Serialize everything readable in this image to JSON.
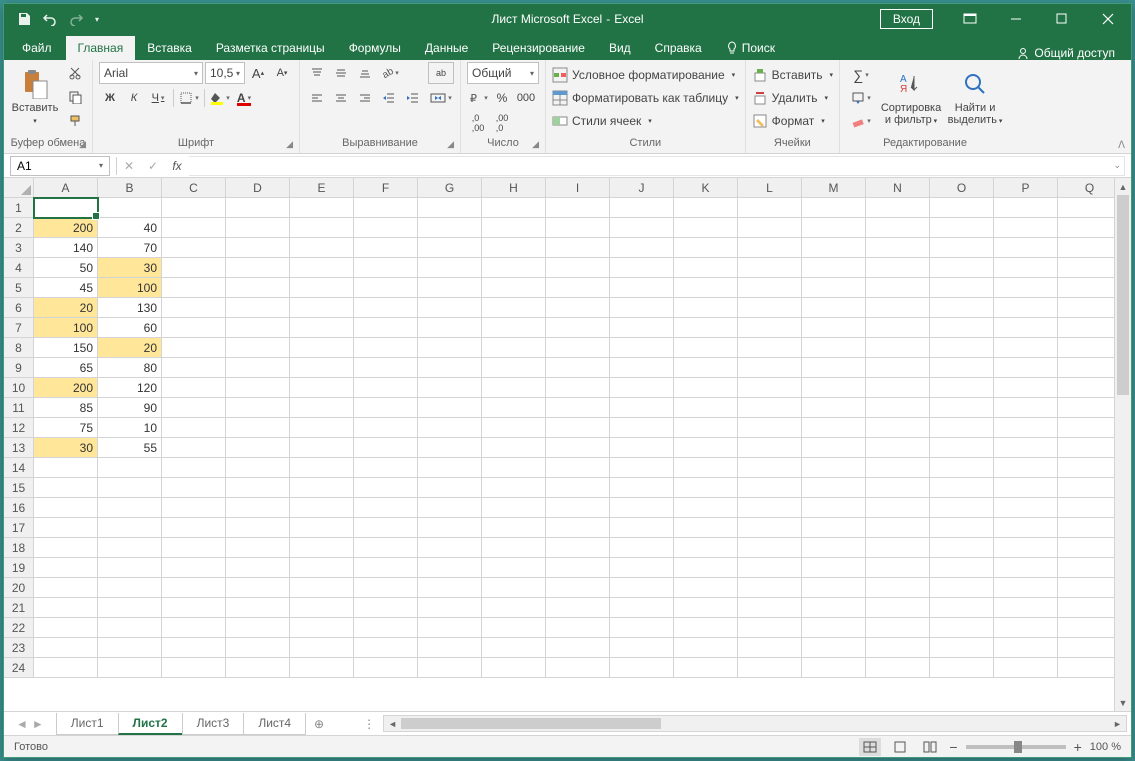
{
  "title": {
    "doc": "Лист Microsoft Excel",
    "sep": "-",
    "app": "Excel"
  },
  "signin": "Вход",
  "tabs": [
    "Файл",
    "Главная",
    "Вставка",
    "Разметка страницы",
    "Формулы",
    "Данные",
    "Рецензирование",
    "Вид",
    "Справка"
  ],
  "active_tab": 1,
  "search": "Поиск",
  "share": "Общий доступ",
  "ribbon": {
    "clipboard": {
      "paste": "Вставить",
      "label": "Буфер обмена"
    },
    "font": {
      "name": "Arial",
      "size": "10,5",
      "label": "Шрифт",
      "bold": "Ж",
      "italic": "К",
      "underline": "Ч"
    },
    "align": {
      "label": "Выравнивание",
      "wrap": "ab"
    },
    "number": {
      "format": "Общий",
      "label": "Число"
    },
    "styles": {
      "cond": "Условное форматирование",
      "table": "Форматировать как таблицу",
      "cell": "Стили ячеек",
      "label": "Стили"
    },
    "cells": {
      "insert": "Вставить",
      "delete": "Удалить",
      "format": "Формат",
      "label": "Ячейки"
    },
    "editing": {
      "sort": "Сортировка и фильтр",
      "find": "Найти и выделить",
      "label": "Редактирование"
    }
  },
  "namebox": "A1",
  "columns": [
    "A",
    "B",
    "C",
    "D",
    "E",
    "F",
    "G",
    "H",
    "I",
    "J",
    "K",
    "L",
    "M",
    "N",
    "O",
    "P",
    "Q"
  ],
  "rows": 24,
  "selected": {
    "r": 1,
    "c": 1
  },
  "cells": {
    "A2": {
      "v": "200",
      "hl": true
    },
    "B2": {
      "v": "40"
    },
    "A3": {
      "v": "140"
    },
    "B3": {
      "v": "70"
    },
    "A4": {
      "v": "50"
    },
    "B4": {
      "v": "30",
      "hl": true
    },
    "A5": {
      "v": "45"
    },
    "B5": {
      "v": "100",
      "hl": true
    },
    "A6": {
      "v": "20",
      "hl": true
    },
    "B6": {
      "v": "130"
    },
    "A7": {
      "v": "100",
      "hl": true
    },
    "B7": {
      "v": "60"
    },
    "A8": {
      "v": "150"
    },
    "B8": {
      "v": "20",
      "hl": true
    },
    "A9": {
      "v": "65"
    },
    "B9": {
      "v": "80"
    },
    "A10": {
      "v": "200",
      "hl": true
    },
    "B10": {
      "v": "120"
    },
    "A11": {
      "v": "85"
    },
    "B11": {
      "v": "90"
    },
    "A12": {
      "v": "75"
    },
    "B12": {
      "v": "10"
    },
    "A13": {
      "v": "30",
      "hl": true
    },
    "B13": {
      "v": "55"
    }
  },
  "sheets": [
    "Лист1",
    "Лист2",
    "Лист3",
    "Лист4"
  ],
  "active_sheet": 1,
  "status": "Готово",
  "zoom": "100 %"
}
